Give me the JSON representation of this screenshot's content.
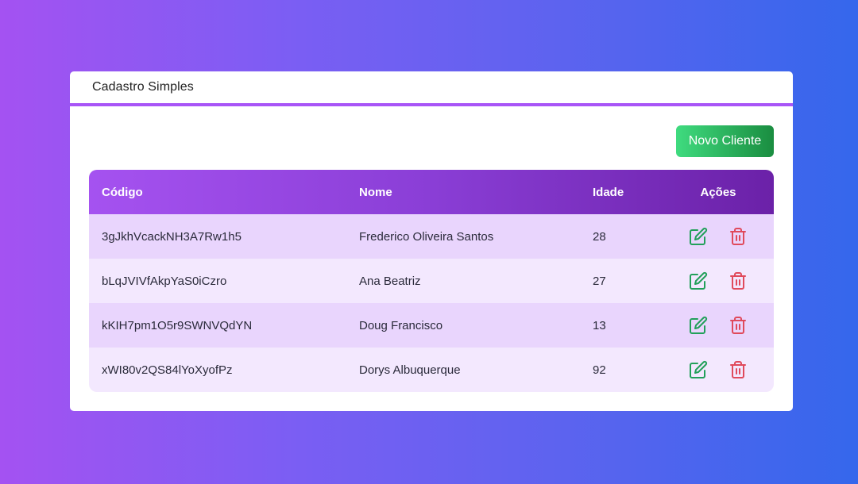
{
  "header": {
    "title": "Cadastro Simples"
  },
  "toolbar": {
    "new_client_label": "Novo Cliente"
  },
  "colors": {
    "edit_icon": "#22a05a",
    "delete_icon": "#e04a5c",
    "accent": "#a855f7"
  },
  "icons": {
    "edit": "edit-icon",
    "delete": "trash-icon"
  },
  "table": {
    "columns": [
      "Código",
      "Nome",
      "Idade",
      "Ações"
    ],
    "rows": [
      {
        "codigo": "3gJkhVcackNH3A7Rw1h5",
        "nome": "Frederico Oliveira Santos",
        "idade": "28"
      },
      {
        "codigo": "bLqJVIVfAkpYaS0iCzro",
        "nome": "Ana Beatriz",
        "idade": "27"
      },
      {
        "codigo": "kKIH7pm1O5r9SWNVQdYN",
        "nome": "Doug Francisco",
        "idade": "13"
      },
      {
        "codigo": "xWI80v2QS84lYoXyofPz",
        "nome": "Dorys Albuquerque",
        "idade": "92"
      }
    ]
  }
}
